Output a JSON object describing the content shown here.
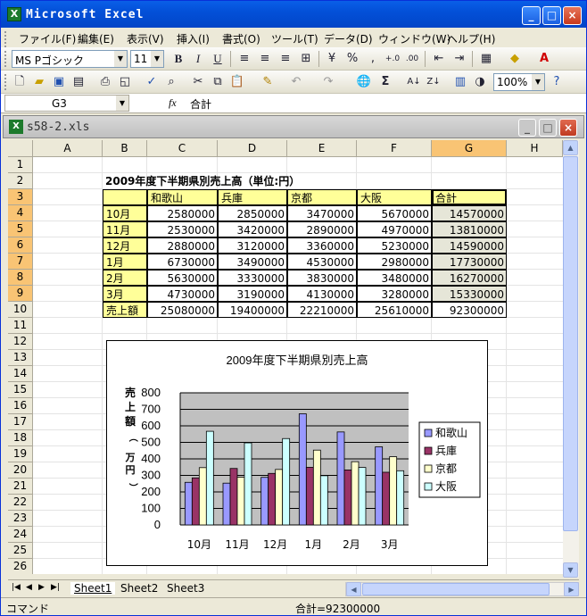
{
  "titlebar": {
    "title": "Microsoft Excel",
    "minimize": "_",
    "maximize": "□",
    "close": "×"
  },
  "menu": [
    "ファイル(F)",
    "編集(E)",
    "表示(V)",
    "挿入(I)",
    "書式(O)",
    "ツール(T)",
    "データ(D)",
    "ウィンドウ(W)",
    "ヘルプ(H)"
  ],
  "format_toolbar": {
    "font": "MS Pゴシック",
    "size": "11",
    "bold": "B",
    "italic": "I",
    "underline": "U",
    "currency": "%",
    "comma": ","
  },
  "std_toolbar": {
    "zoom": "100%",
    "sigma": "Σ"
  },
  "formula_bar": {
    "name_box": "G3",
    "fx": "fx",
    "value": "合計"
  },
  "workbook": {
    "title": "s58-2.xls",
    "minimize": "_",
    "maximize": "□",
    "close": "×"
  },
  "columns": [
    "A",
    "B",
    "C",
    "D",
    "E",
    "F",
    "G",
    "H"
  ],
  "rows": [
    "1",
    "2",
    "3",
    "4",
    "5",
    "6",
    "7",
    "8",
    "9",
    "10",
    "11",
    "12",
    "13",
    "14",
    "15",
    "16",
    "17",
    "18",
    "19",
    "20",
    "21",
    "22",
    "23",
    "24",
    "25",
    "26"
  ],
  "table": {
    "title": "2009年度下半期県別売上高（単位:円）",
    "headers": [
      "和歌山",
      "兵庫",
      "京都",
      "大阪",
      "合計"
    ],
    "rows": [
      {
        "label": "10月",
        "vals": [
          "2580000",
          "2850000",
          "3470000",
          "5670000",
          "14570000"
        ]
      },
      {
        "label": "11月",
        "vals": [
          "2530000",
          "3420000",
          "2890000",
          "4970000",
          "13810000"
        ]
      },
      {
        "label": "12月",
        "vals": [
          "2880000",
          "3120000",
          "3360000",
          "5230000",
          "14590000"
        ]
      },
      {
        "label": "1月",
        "vals": [
          "6730000",
          "3490000",
          "4530000",
          "2980000",
          "17730000"
        ]
      },
      {
        "label": "2月",
        "vals": [
          "5630000",
          "3330000",
          "3830000",
          "3480000",
          "16270000"
        ]
      },
      {
        "label": "3月",
        "vals": [
          "4730000",
          "3190000",
          "4130000",
          "3280000",
          "15330000"
        ]
      }
    ],
    "total": {
      "label": "売上額",
      "vals": [
        "25080000",
        "19400000",
        "22210000",
        "25610000",
        "92300000"
      ]
    }
  },
  "chart_data": {
    "type": "bar",
    "title": "2009年度下半期県別売上高",
    "ylabel": "売上額（万円）",
    "xlabel": "",
    "categories": [
      "10月",
      "11月",
      "12月",
      "1月",
      "2月",
      "3月"
    ],
    "series": [
      {
        "name": "和歌山",
        "values": [
          258,
          253,
          288,
          673,
          563,
          473
        ],
        "color": "#9999ff"
      },
      {
        "name": "兵庫",
        "values": [
          285,
          342,
          312,
          349,
          333,
          319
        ],
        "color": "#993366"
      },
      {
        "name": "京都",
        "values": [
          347,
          289,
          336,
          453,
          383,
          413
        ],
        "color": "#ffffcc"
      },
      {
        "name": "大阪",
        "values": [
          567,
          497,
          523,
          298,
          348,
          328
        ],
        "color": "#ccffff"
      }
    ],
    "ylim": [
      0,
      800
    ],
    "yticks": [
      "0",
      "100",
      "200",
      "300",
      "400",
      "500",
      "600",
      "700",
      "800"
    ],
    "grid": true,
    "legend": "right",
    "plot_bg": "#c0c0c0"
  },
  "sheets": [
    "Sheet1",
    "Sheet2",
    "Sheet3"
  ],
  "status": {
    "mode": "コマンド",
    "sum": "合計=92300000"
  }
}
